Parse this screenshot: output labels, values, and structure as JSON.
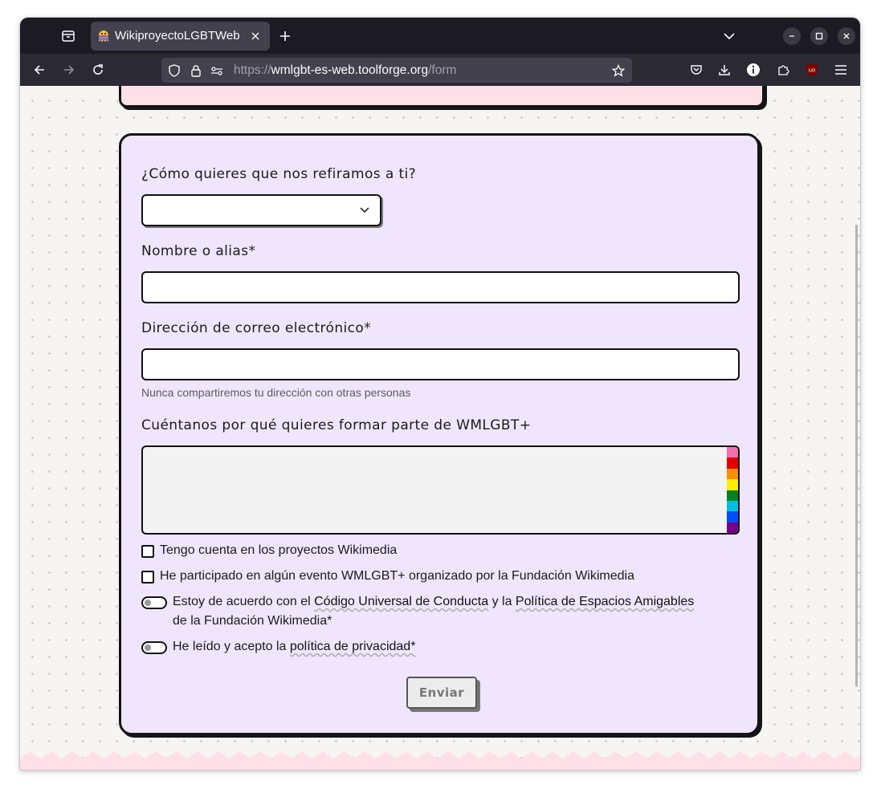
{
  "browser": {
    "tab_title": "WikiproyectoLGBTWeb",
    "url_prefix": "https://",
    "url_domain": "wmlgbt-es-web.toolforge.org",
    "url_path": "/form"
  },
  "form": {
    "pronoun_label": "¿Cómo quieres que nos refiramos a ti?",
    "pronoun_value": "",
    "name_label": "Nombre o alias*",
    "name_value": "",
    "email_label": "Dirección de correo electrónico*",
    "email_value": "",
    "email_help": "Nunca compartiremos tu dirección con otras personas",
    "reason_label": "Cuéntanos por qué quieres formar parte de WMLGBT+",
    "reason_value": "",
    "rainbow_colors": [
      "#f26fab",
      "#e50000",
      "#ff8d00",
      "#ffee00",
      "#028121",
      "#00c0e0",
      "#004cff",
      "#770088"
    ],
    "checkbox_account": "Tengo cuenta en los proyectos Wikimedia",
    "checkbox_event": "He participado en algún evento WMLGBT+ organizado por la Fundación Wikimedia",
    "conduct_text_1": "Estoy de acuerdo con el ",
    "conduct_link_1": "Código Universal de Conducta",
    "conduct_text_2": " y la ",
    "conduct_link_2": "Política de Espacios Amigables",
    "conduct_text_3": "de la Fundación Wikimedia*",
    "privacy_text": "He leído y acepto la ",
    "privacy_link": "política de privacidad*",
    "submit_label": "Enviar"
  }
}
